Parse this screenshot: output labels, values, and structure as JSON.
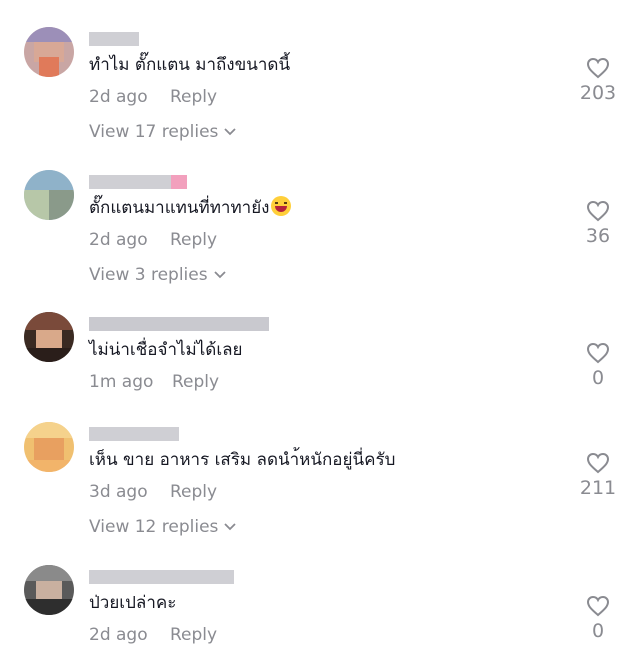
{
  "comments": [
    {
      "text": "ทำไม ตั๊กแตน มาถึงขนาดนี้",
      "date": "2d ago",
      "reply_label": "Reply",
      "likes": "203",
      "view_replies": "View 17 replies",
      "has_emoji": false
    },
    {
      "text": "ตั๊กแตนมาแทนที่ทาทายัง",
      "date": "2d ago",
      "reply_label": "Reply",
      "likes": "36",
      "view_replies": "View 3 replies",
      "has_emoji": true,
      "emoji_icon": "laughing-emoji-icon"
    },
    {
      "text": "ไม่น่าเชื่อจำไม่ได้เลย",
      "date": "1m ago",
      "reply_label": "Reply",
      "likes": "0",
      "view_replies": "",
      "has_emoji": false
    },
    {
      "text": "เห็น ขาย อาหาร เสริม ลดนำ้หนักอยู่นี่ครับ",
      "date": "3d ago",
      "reply_label": "Reply",
      "likes": "211",
      "view_replies": "View 12 replies",
      "has_emoji": false
    },
    {
      "text": "ป่วยเปล่าคะ",
      "date": "2d ago",
      "reply_label": "Reply",
      "likes": "0",
      "view_replies": "",
      "has_emoji": false
    }
  ],
  "icons": {
    "like": "heart-outline-icon",
    "expand": "chevron-down-icon"
  },
  "colors": {
    "text": "#161823",
    "muted": "#8a8b91",
    "background": "#ffffff"
  }
}
